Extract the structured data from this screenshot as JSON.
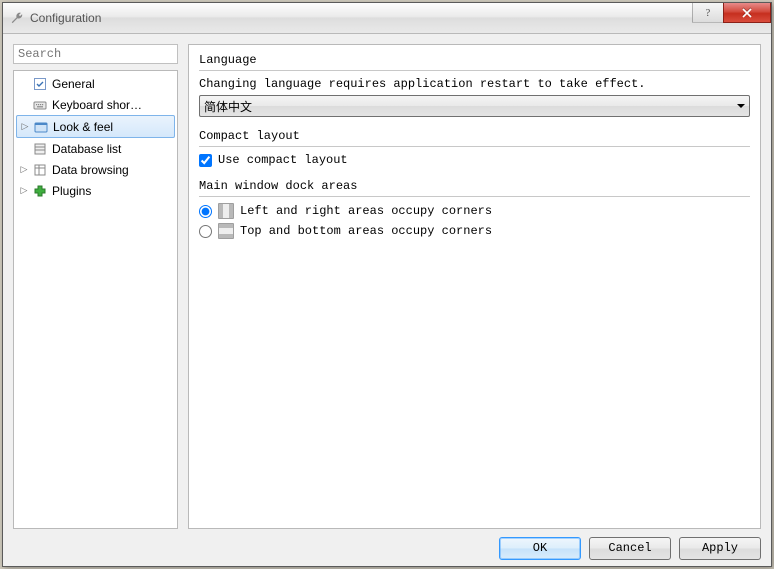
{
  "window": {
    "title": "Configuration"
  },
  "search": {
    "placeholder": "Search"
  },
  "tree": {
    "items": [
      {
        "label": "General",
        "icon": "checkbox-icon",
        "expander": "",
        "selected": false
      },
      {
        "label": "Keyboard shor…",
        "icon": "keyboard-icon",
        "expander": "",
        "selected": false
      },
      {
        "label": "Look & feel",
        "icon": "appearance-icon",
        "expander": "▷",
        "selected": true
      },
      {
        "label": "Database list",
        "icon": "database-icon",
        "expander": "",
        "selected": false
      },
      {
        "label": "Data browsing",
        "icon": "table-icon",
        "expander": "▷",
        "selected": false
      },
      {
        "label": "Plugins",
        "icon": "plugin-icon",
        "expander": "▷",
        "selected": false
      }
    ]
  },
  "sections": {
    "language": {
      "header": "Language",
      "hint": "Changing language requires application restart to take effect.",
      "value": "简体中文"
    },
    "compact": {
      "header": "Compact layout",
      "checkbox_label": "Use compact layout",
      "checked": true
    },
    "dock": {
      "header": "Main window dock areas",
      "option1": "Left and right areas occupy corners",
      "option2": "Top and bottom areas occupy corners",
      "selected": 0
    }
  },
  "buttons": {
    "ok": "OK",
    "cancel": "Cancel",
    "apply": "Apply"
  }
}
